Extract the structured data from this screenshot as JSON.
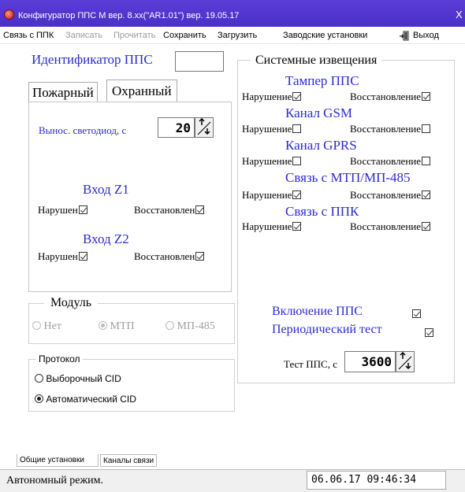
{
  "window": {
    "title": "Конфигуратор ППС М вер. 8.xx(\"AR1.01\") вер. 19.05.17",
    "close": "X"
  },
  "menu": {
    "items": [
      {
        "label": "Связь с ППК"
      },
      {
        "label": "Записать"
      },
      {
        "label": "Прочитать"
      },
      {
        "label": "Сохранить"
      },
      {
        "label": "Загрузить"
      },
      {
        "label": "Заводские установки"
      },
      {
        "label": "Выход"
      }
    ],
    "exit_icon": "exit-door-icon"
  },
  "identifier": {
    "label": "Идентификатор ППС",
    "value": ""
  },
  "tabs": {
    "fire": "Пожарный",
    "security": "Охранный",
    "active": "security"
  },
  "security": {
    "led_label": "Вынос. светодиод, с",
    "led_value": "20",
    "inputs": [
      {
        "title": "Вход Z1",
        "violated_label": "Нарушен",
        "violated": true,
        "restored_label": "Восстановлен",
        "restored": true
      },
      {
        "title": "Вход Z2",
        "violated_label": "Нарушен",
        "violated": true,
        "restored_label": "Восстановлен",
        "restored": true
      }
    ]
  },
  "module": {
    "label": "Модуль",
    "options": [
      "Нет",
      "МТП",
      "МП-485"
    ],
    "selected": "МТП",
    "disabled": true
  },
  "protocol": {
    "label": "Протокол",
    "options": [
      "Выборочный CID",
      "Автоматический CID"
    ],
    "selected": "Автоматический CID"
  },
  "system": {
    "label": "Системные извещения",
    "violation_label": "Нарушение",
    "restore_label": "Восстановление",
    "groups": [
      {
        "title": "Тампер ППС",
        "violation": true,
        "restore": true
      },
      {
        "title": "Канал GSM",
        "violation": false,
        "restore": false
      },
      {
        "title": "Канал GPRS",
        "violation": false,
        "restore": false
      },
      {
        "title": "Связь с МТП/МП-485",
        "violation": true,
        "restore": true
      },
      {
        "title": "Связь с ППК",
        "violation": true,
        "restore": true
      }
    ],
    "power_on_label": "Включение ППС",
    "power_on": true,
    "periodic_label": "Периодический тест",
    "periodic": true,
    "test_label": "Тест ППС,  с",
    "test_value": "3600"
  },
  "bottom_tabs": {
    "general": "Общие установки",
    "channels": "Каналы связи"
  },
  "status": {
    "mode": "Автономный режим.",
    "datetime": "06.06.17  09:46:34"
  },
  "colors": {
    "title_bar": "#4a2fc8",
    "accent_text": "#2b2bd0"
  }
}
